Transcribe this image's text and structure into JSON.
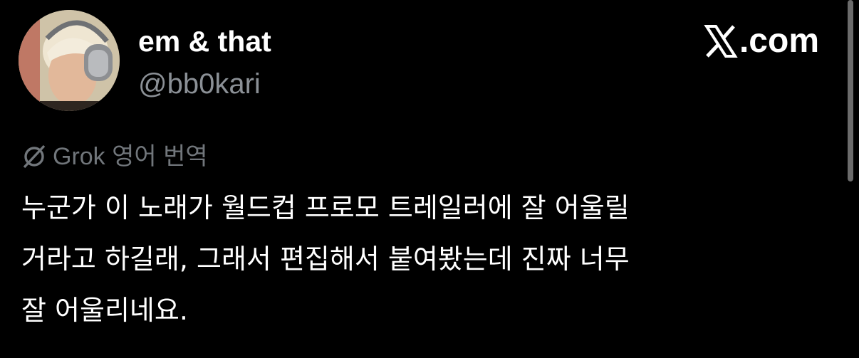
{
  "author": {
    "display_name": "em & that",
    "handle": "@bb0kari",
    "avatar_icon": "user-avatar"
  },
  "brand": {
    "label": ".com",
    "icon": "x-logo-icon"
  },
  "translation": {
    "label": "Grok 영어 번역",
    "icon": "grok-icon"
  },
  "tweet": {
    "lines": [
      "누군가 이 노래가 월드컵 프로모 트레일러에 잘 어울릴",
      "거라고 하길래, 그래서 편집해서 붙여봤는데 진짜 너무",
      "잘 어울리네요."
    ]
  },
  "colors": {
    "background": "#000000",
    "primary_text": "#ffffff",
    "secondary_text": "#71767b",
    "scrollbar": "#6b6b6b"
  }
}
